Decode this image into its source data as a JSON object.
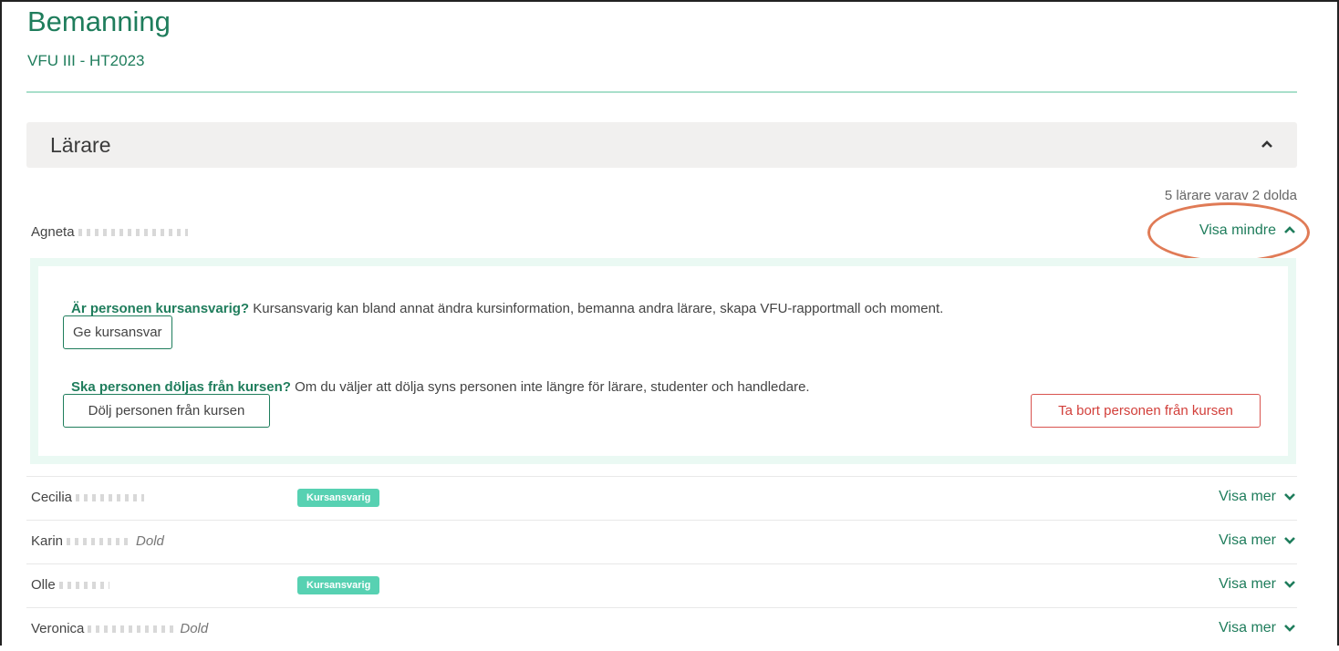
{
  "page": {
    "title": "Bemanning",
    "subtitle": "VFU III - HT2023"
  },
  "section": {
    "title": "Lärare",
    "summary": "5 lärare varav 2 dolda"
  },
  "expanded_person": {
    "name": "Agneta",
    "toggle_label": "Visa mindre",
    "course_responsible": {
      "question": "Är personen kursansvarig?",
      "description": "Kursansvarig kan bland annat ändra kursinformation, bemanna andra lärare, skapa VFU-rapportmall och moment.",
      "button": "Ge kursansvar"
    },
    "hide": {
      "question": "Ska personen döljas från kursen?",
      "description": "Om du väljer att dölja syns personen inte längre för lärare, studenter och handledare.",
      "button": "Dölj personen från kursen"
    },
    "remove_button": "Ta bort personen från kursen"
  },
  "people": [
    {
      "name": "Cecilia",
      "badge": "Kursansvarig",
      "dold": "",
      "toggle": "Visa mer"
    },
    {
      "name": "Karin",
      "badge": "",
      "dold": "Dold",
      "toggle": "Visa mer"
    },
    {
      "name": "Olle",
      "badge": "Kursansvarig",
      "dold": "",
      "toggle": "Visa mer"
    },
    {
      "name": "Veronica",
      "badge": "",
      "dold": "Dold",
      "toggle": "Visa mer"
    }
  ],
  "colors": {
    "brand": "#1f7d5c",
    "badge": "#57d1b2",
    "danger": "#d23f3a",
    "highlight": "#e07b56"
  }
}
